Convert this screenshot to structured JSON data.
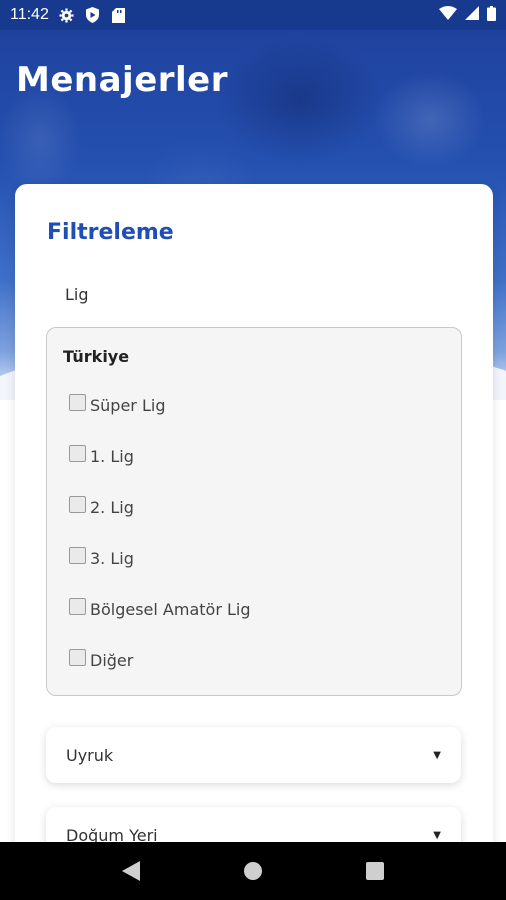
{
  "status_bar": {
    "time": "11:42",
    "icons": [
      "gear-icon",
      "play-protect-icon",
      "sd-card-icon",
      "wifi-icon",
      "signal-icon",
      "battery-icon"
    ]
  },
  "header": {
    "title": "Menajerler"
  },
  "filter": {
    "title": "Filtreleme",
    "league_label": "Lig",
    "country": "Türkiye",
    "options": [
      {
        "label": "Süper Lig",
        "checked": false
      },
      {
        "label": "1. Lig",
        "checked": false
      },
      {
        "label": "2. Lig",
        "checked": false
      },
      {
        "label": "3. Lig",
        "checked": false
      },
      {
        "label": "Bölgesel Amatör Lig",
        "checked": false
      },
      {
        "label": "Diğer",
        "checked": false
      }
    ],
    "nationality_select": "Uyruk",
    "birthplace_select": "Doğum Yeri"
  },
  "colors": {
    "accent": "#1f4fb5",
    "hero_top": "#1e3f9a",
    "status_bar": "#173a8e"
  },
  "nav": {
    "icons": [
      "back-icon",
      "home-icon",
      "recents-icon"
    ]
  }
}
